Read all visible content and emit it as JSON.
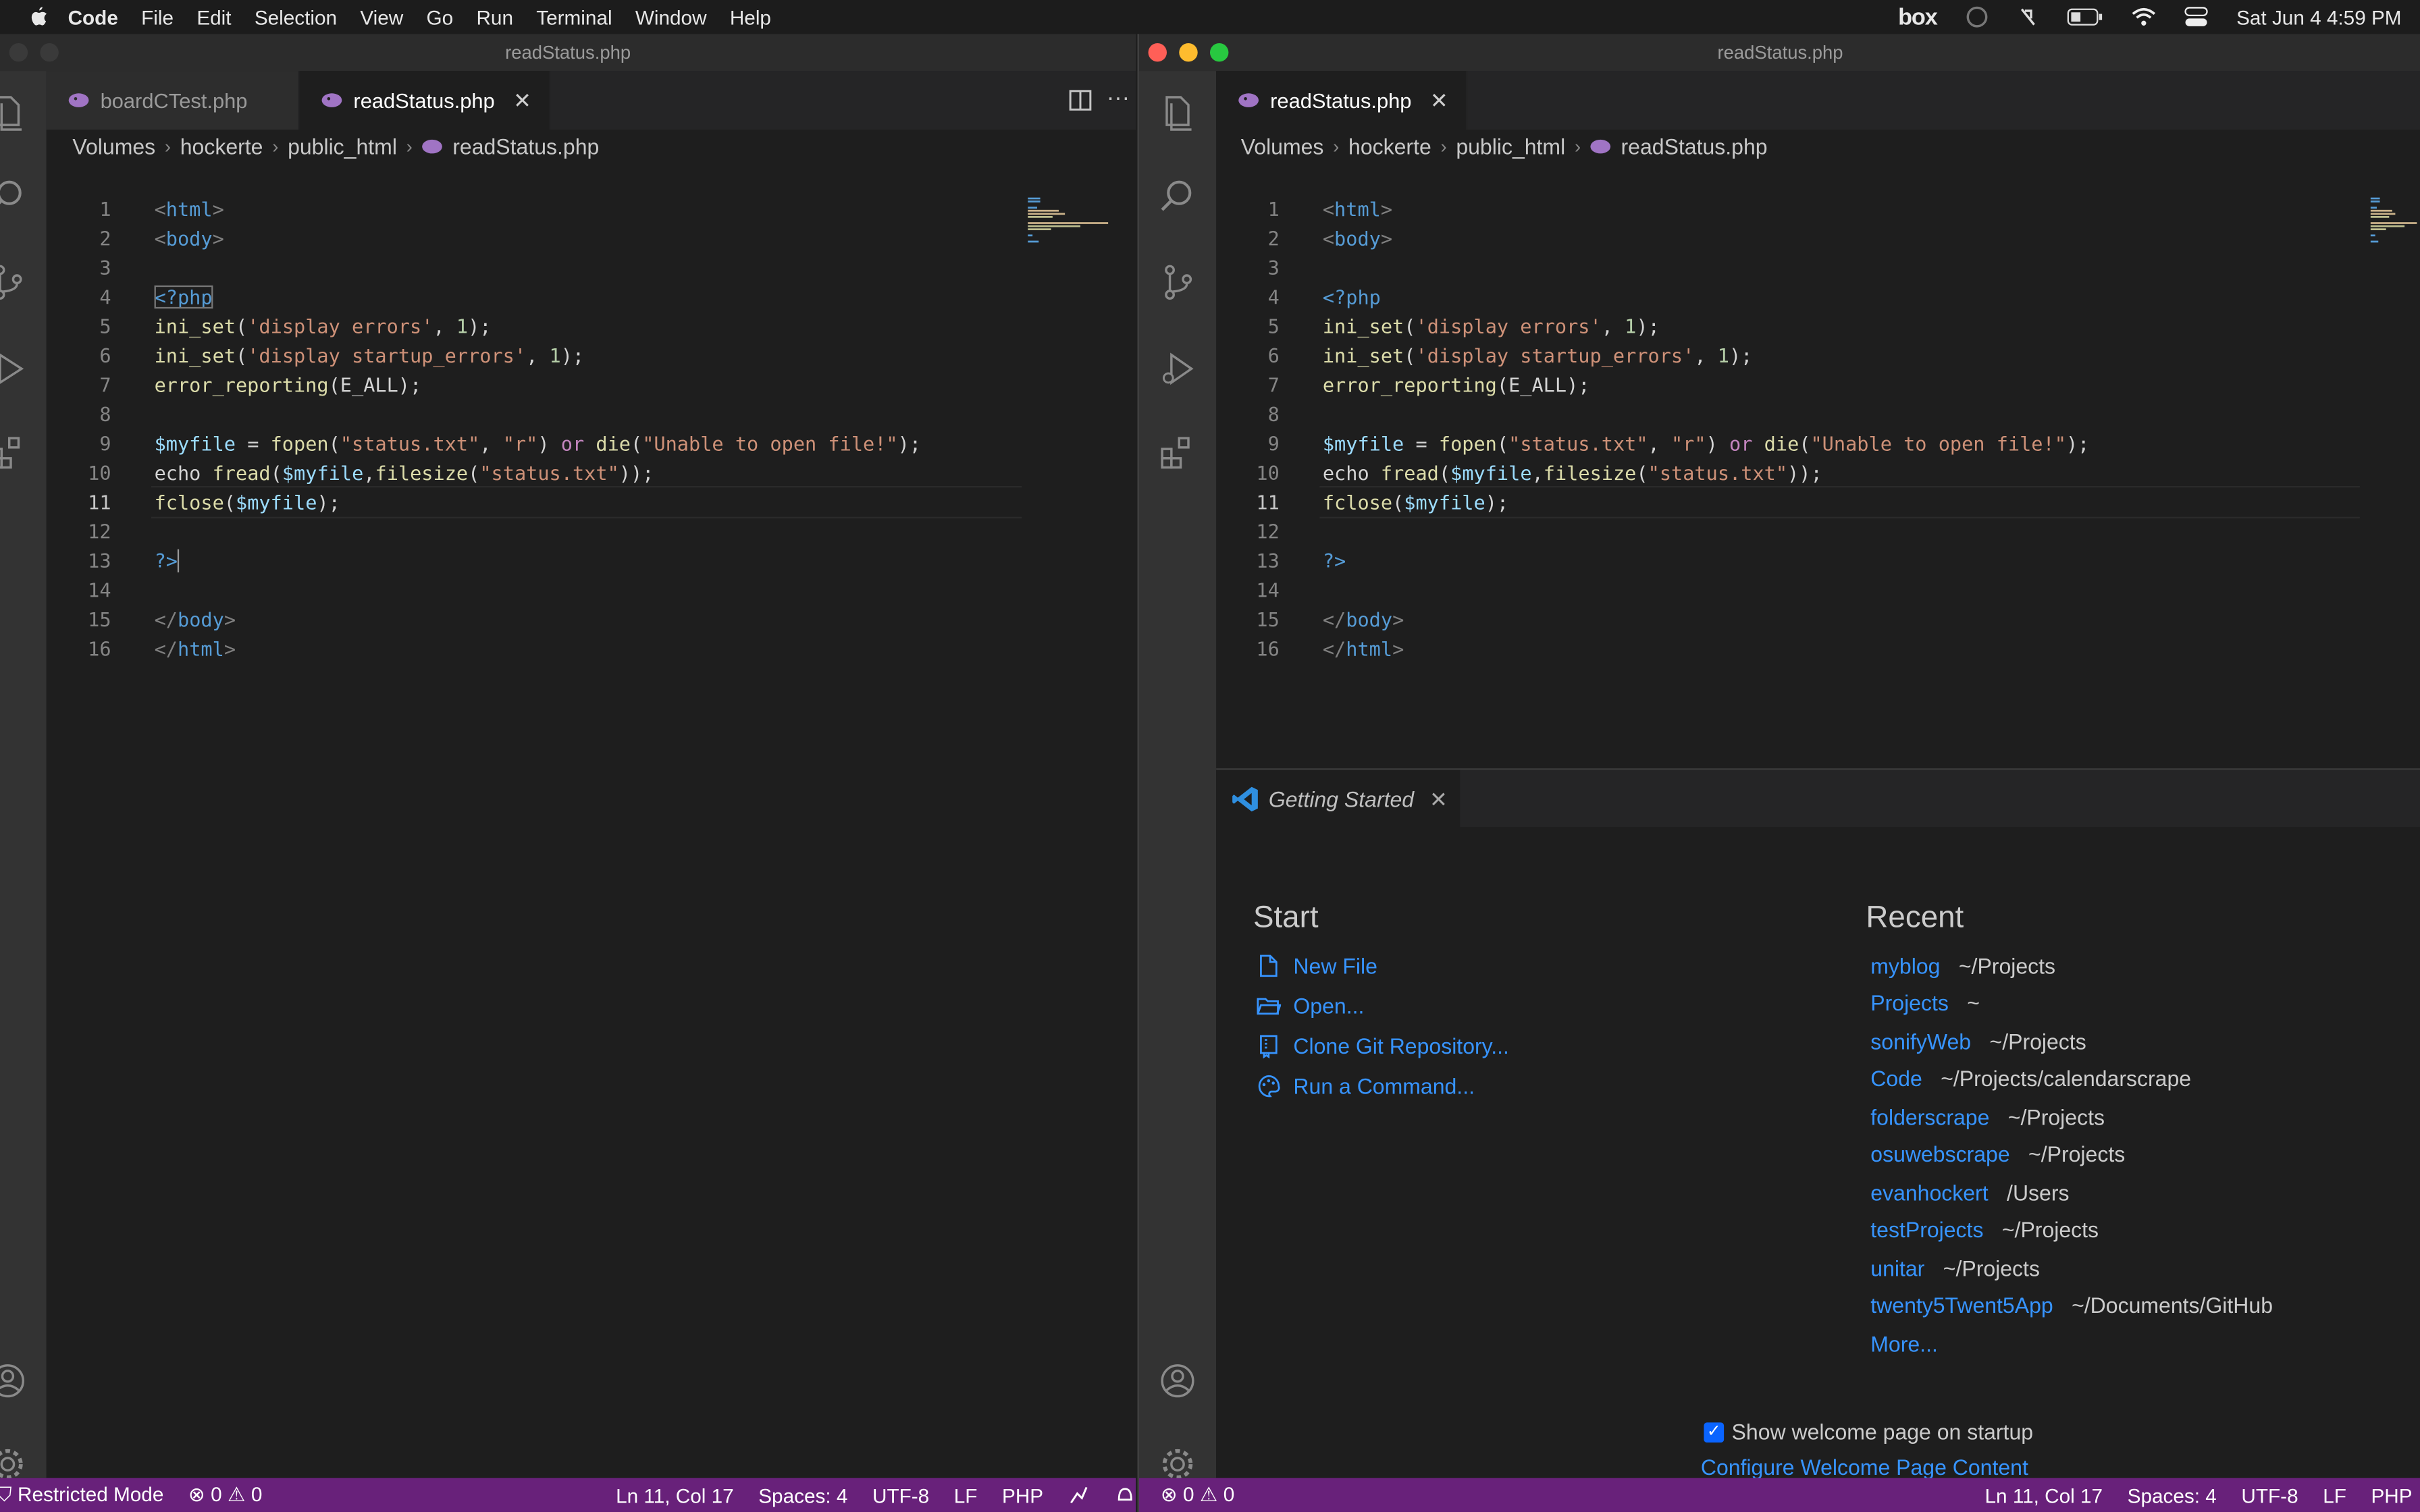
{
  "menubar": {
    "app": "Code",
    "items": [
      "File",
      "Edit",
      "Selection",
      "View",
      "Go",
      "Run",
      "Terminal",
      "Window",
      "Help"
    ],
    "box": "box",
    "clock": "Sat Jun 4  4:59 PM"
  },
  "left_window": {
    "title": "readStatus.php",
    "tabs": [
      {
        "label": "boardCTest.php",
        "active": false
      },
      {
        "label": "readStatus.php",
        "active": true
      }
    ],
    "breadcrumb": [
      "Volumes",
      "hockerte",
      "public_html",
      "readStatus.php"
    ],
    "status": {
      "mode": "Restricted Mode",
      "errors": "0",
      "warnings": "0",
      "position": "Ln 11, Col 17",
      "spaces": "Spaces: 4",
      "encoding": "UTF-8",
      "eol": "LF",
      "language": "PHP"
    }
  },
  "right_window": {
    "title": "readStatus.php",
    "tab": "readStatus.php",
    "breadcrumb": [
      "Volumes",
      "hockerte",
      "public_html",
      "readStatus.php"
    ],
    "welcome_tab": "Getting Started",
    "start_heading": "Start",
    "start_items": [
      "New File",
      "Open...",
      "Clone Git Repository...",
      "Run a Command..."
    ],
    "recent_heading": "Recent",
    "recent": [
      {
        "name": "myblog",
        "path": "~/Projects"
      },
      {
        "name": "Projects",
        "path": "~"
      },
      {
        "name": "sonifyWeb",
        "path": "~/Projects"
      },
      {
        "name": "Code",
        "path": "~/Projects/calendarscrape"
      },
      {
        "name": "folderscrape",
        "path": "~/Projects"
      },
      {
        "name": "osuwebscrape",
        "path": "~/Projects"
      },
      {
        "name": "evanhockert",
        "path": "/Users"
      },
      {
        "name": "testProjects",
        "path": "~/Projects"
      },
      {
        "name": "unitar",
        "path": "~/Projects"
      },
      {
        "name": "twenty5Twent5App",
        "path": "~/Documents/GitHub"
      }
    ],
    "more": "More...",
    "show_welcome": "Show welcome page on startup",
    "configure": "Configure Welcome Page Content",
    "status": {
      "errors": "0",
      "warnings": "0",
      "position": "Ln 11, Col 17",
      "spaces": "Spaces: 4",
      "encoding": "UTF-8",
      "eol": "LF",
      "language": "PHP"
    }
  },
  "code": {
    "numbers": [
      "1",
      "2",
      "3",
      "4",
      "5",
      "6",
      "7",
      "8",
      "9",
      "10",
      "11",
      "12",
      "13",
      "14",
      "15",
      "16"
    ],
    "l1": [
      "<",
      "html",
      ">"
    ],
    "l2": [
      "<",
      "body",
      ">"
    ],
    "l4": "<?php",
    "l5": [
      "ini_set",
      "(",
      "'display errors'",
      ", ",
      "1",
      ");"
    ],
    "l6": [
      "ini_set",
      "(",
      "'display startup_errors'",
      ", ",
      "1",
      ");"
    ],
    "l7": [
      "error_reporting",
      "(E_ALL);"
    ],
    "l9": [
      "$myfile",
      " = ",
      "fopen",
      "(",
      "\"status.txt\"",
      ", ",
      "\"r\"",
      ") ",
      "or",
      " ",
      "die",
      "(",
      "\"Unable to open file!\"",
      ");"
    ],
    "l10": [
      "echo ",
      "fread",
      "(",
      "$myfile",
      ",",
      "filesize",
      "(",
      "\"status.txt\"",
      "));"
    ],
    "l11": [
      "fclose",
      "(",
      "$myfile",
      ");"
    ],
    "l13": "?>",
    "l15": [
      "</",
      "body",
      ">"
    ],
    "l16": [
      "</",
      "html",
      ">"
    ]
  }
}
